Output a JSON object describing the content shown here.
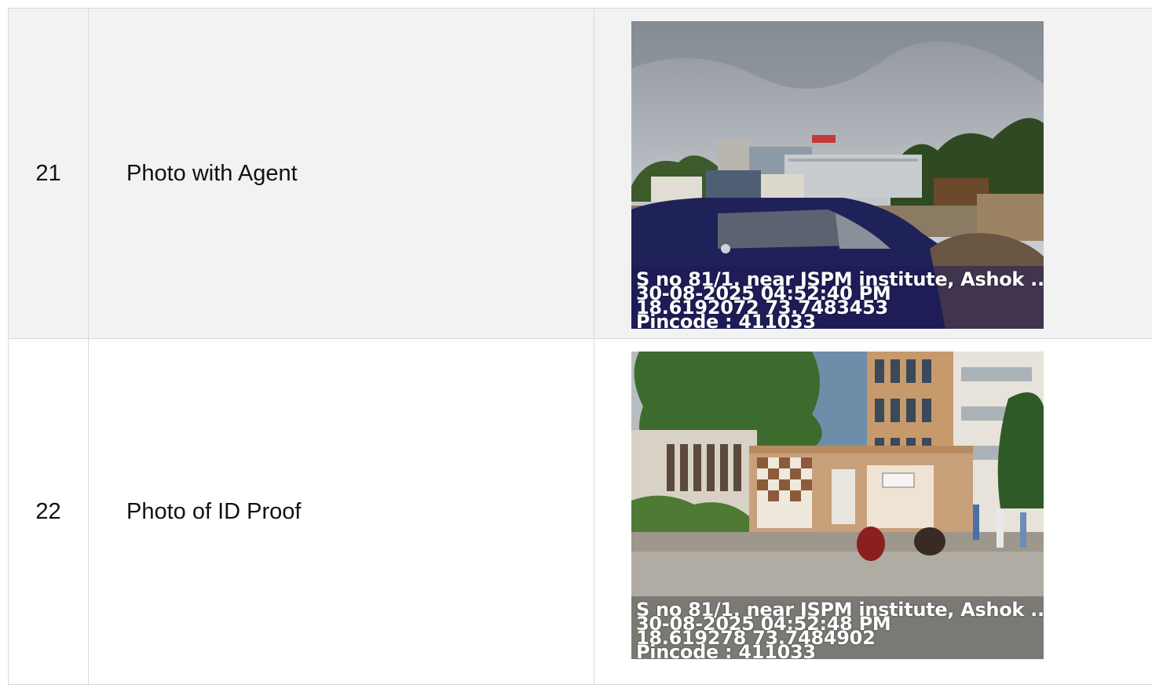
{
  "rows": [
    {
      "number": "21",
      "label": "Photo with Agent",
      "overlay": {
        "address": "S no 81/1, near JSPM institute, Ashok ...",
        "datetime": "30-08-2025 04:52:40 PM",
        "coordinates": "18.6192072 73.7483453",
        "pincode": "Pincode : 411033"
      }
    },
    {
      "number": "22",
      "label": "Photo of ID Proof",
      "overlay": {
        "address": "S no 81/1, near JSPM institute, Ashok ...",
        "datetime": "30-08-2025 04:52:48 PM",
        "coordinates": "18.619278 73.7484902",
        "pincode": "Pincode : 411033"
      }
    }
  ]
}
